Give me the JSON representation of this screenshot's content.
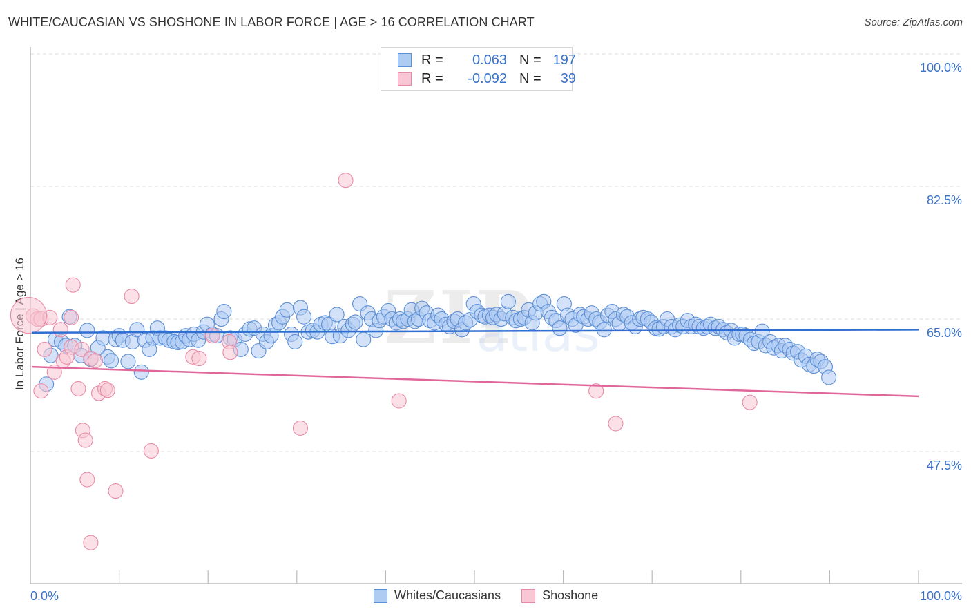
{
  "header": {
    "title": "WHITE/CAUCASIAN VS SHOSHONE IN LABOR FORCE | AGE > 16 CORRELATION CHART",
    "source": "Source: ZipAtlas.com"
  },
  "watermark": {
    "part1": "ZIP",
    "part2": "atlas"
  },
  "legend": {
    "rows": [
      {
        "r_label": "R =",
        "r_value": "0.063",
        "n_label": "N =",
        "n_value": "197",
        "color": "#aecbf2",
        "border": "#5b8fd6"
      },
      {
        "r_label": "R =",
        "r_value": "-0.092",
        "n_label": "N =",
        "n_value": "39",
        "color": "#f8c6d4",
        "border": "#e88aa6"
      }
    ]
  },
  "bottom_legend": {
    "items": [
      {
        "label": "Whites/Caucasians",
        "color": "#aecbf2",
        "border": "#5b8fd6"
      },
      {
        "label": "Shoshone",
        "color": "#f8c6d4",
        "border": "#e88aa6"
      }
    ]
  },
  "chart_data": {
    "type": "scatter",
    "title": "WHITE/CAUCASIAN VS SHOSHONE IN LABOR FORCE | AGE > 16 CORRELATION CHART",
    "xlabel": "",
    "ylabel": "In Labor Force | Age > 16",
    "xlim": [
      0,
      100
    ],
    "ylim": [
      30.5,
      102
    ],
    "x_tick_labels": [
      "0.0%",
      "100.0%"
    ],
    "y_ticks": [
      100.0,
      82.5,
      65.0,
      47.5
    ],
    "y_tick_labels": [
      "100.0%",
      "82.5%",
      "65.0%",
      "47.5%"
    ],
    "grid": true,
    "legend_position": "top-center",
    "series": [
      {
        "name": "Whites/Caucasians",
        "color": "#6b9ee0",
        "R": 0.063,
        "N": 197,
        "trend": {
          "x": [
            0,
            100
          ],
          "y": [
            63.2,
            63.6
          ]
        },
        "points": [
          [
            1.8,
            56.4
          ],
          [
            2.3,
            60.2
          ],
          [
            2.8,
            62.3
          ],
          [
            3.5,
            62.0
          ],
          [
            4.0,
            61.5
          ],
          [
            4.4,
            65.3
          ],
          [
            5.0,
            61.5
          ],
          [
            5.7,
            60.2
          ],
          [
            6.4,
            63.5
          ],
          [
            6.8,
            59.7
          ],
          [
            7.6,
            61.2
          ],
          [
            8.2,
            62.5
          ],
          [
            8.7,
            60.0
          ],
          [
            9.1,
            59.5
          ],
          [
            9.6,
            62.3
          ],
          [
            10.0,
            62.8
          ],
          [
            10.4,
            62.2
          ],
          [
            11.0,
            59.4
          ],
          [
            11.5,
            62.0
          ],
          [
            12.0,
            63.6
          ],
          [
            12.5,
            58.0
          ],
          [
            12.9,
            62.2
          ],
          [
            13.4,
            61.0
          ],
          [
            13.8,
            62.5
          ],
          [
            14.3,
            63.8
          ],
          [
            14.6,
            62.5
          ],
          [
            15.2,
            62.5
          ],
          [
            15.6,
            62.2
          ],
          [
            16.2,
            62.0
          ],
          [
            16.6,
            61.9
          ],
          [
            17.1,
            62.0
          ],
          [
            17.5,
            62.8
          ],
          [
            17.9,
            62.3
          ],
          [
            18.4,
            63.0
          ],
          [
            18.9,
            62.2
          ],
          [
            19.5,
            63.3
          ],
          [
            19.9,
            64.3
          ],
          [
            20.5,
            63.0
          ],
          [
            21.0,
            62.8
          ],
          [
            21.5,
            65.0
          ],
          [
            21.8,
            66.0
          ],
          [
            22.5,
            62.5
          ],
          [
            23.0,
            62.3
          ],
          [
            23.7,
            61.0
          ],
          [
            24.2,
            63.0
          ],
          [
            24.7,
            63.7
          ],
          [
            25.2,
            63.8
          ],
          [
            25.7,
            60.8
          ],
          [
            26.2,
            63.0
          ],
          [
            26.6,
            62.0
          ],
          [
            27.1,
            62.8
          ],
          [
            27.6,
            64.2
          ],
          [
            28.0,
            64.5
          ],
          [
            28.4,
            65.3
          ],
          [
            28.9,
            66.2
          ],
          [
            29.4,
            63.0
          ],
          [
            29.8,
            62.0
          ],
          [
            30.4,
            66.5
          ],
          [
            30.8,
            65.3
          ],
          [
            31.3,
            63.3
          ],
          [
            31.8,
            63.5
          ],
          [
            32.3,
            63.3
          ],
          [
            32.7,
            64.3
          ],
          [
            33.2,
            64.5
          ],
          [
            33.6,
            64.3
          ],
          [
            34.0,
            62.7
          ],
          [
            34.5,
            65.6
          ],
          [
            34.9,
            62.8
          ],
          [
            35.4,
            64.0
          ],
          [
            35.8,
            63.5
          ],
          [
            36.3,
            64.3
          ],
          [
            36.6,
            64.6
          ],
          [
            37.1,
            67.0
          ],
          [
            37.5,
            62.3
          ],
          [
            38.0,
            65.8
          ],
          [
            38.4,
            65.0
          ],
          [
            38.9,
            63.5
          ],
          [
            39.3,
            64.8
          ],
          [
            39.8,
            65.3
          ],
          [
            40.3,
            66.1
          ],
          [
            40.7,
            65.0
          ],
          [
            41.2,
            64.5
          ],
          [
            41.6,
            65.0
          ],
          [
            42.0,
            64.7
          ],
          [
            42.5,
            65.0
          ],
          [
            42.9,
            66.2
          ],
          [
            43.3,
            64.7
          ],
          [
            43.7,
            65.0
          ],
          [
            44.1,
            66.4
          ],
          [
            44.6,
            65.8
          ],
          [
            45.0,
            64.8
          ],
          [
            45.5,
            64.5
          ],
          [
            45.9,
            65.5
          ],
          [
            46.3,
            65.0
          ],
          [
            46.8,
            64.3
          ],
          [
            47.2,
            64.0
          ],
          [
            47.7,
            64.7
          ],
          [
            48.1,
            65.0
          ],
          [
            48.6,
            63.6
          ],
          [
            49.0,
            64.5
          ],
          [
            49.5,
            64.9
          ],
          [
            49.9,
            67.0
          ],
          [
            50.3,
            66.0
          ],
          [
            50.8,
            65.5
          ],
          [
            51.2,
            65.3
          ],
          [
            51.7,
            65.5
          ],
          [
            52.1,
            65.2
          ],
          [
            52.5,
            65.6
          ],
          [
            53.0,
            65.0
          ],
          [
            53.4,
            65.7
          ],
          [
            53.8,
            67.3
          ],
          [
            54.3,
            65.2
          ],
          [
            54.7,
            64.8
          ],
          [
            55.2,
            65.0
          ],
          [
            55.6,
            65.2
          ],
          [
            56.1,
            66.2
          ],
          [
            56.5,
            64.5
          ],
          [
            56.9,
            65.8
          ],
          [
            57.4,
            67.0
          ],
          [
            57.8,
            67.3
          ],
          [
            58.3,
            66.0
          ],
          [
            58.7,
            65.2
          ],
          [
            59.2,
            64.8
          ],
          [
            59.6,
            63.8
          ],
          [
            60.1,
            67.0
          ],
          [
            60.5,
            65.5
          ],
          [
            61.0,
            65.0
          ],
          [
            61.4,
            64.2
          ],
          [
            61.9,
            65.6
          ],
          [
            62.3,
            65.3
          ],
          [
            62.8,
            65.0
          ],
          [
            63.2,
            65.8
          ],
          [
            63.7,
            65.0
          ],
          [
            64.1,
            64.6
          ],
          [
            64.6,
            63.6
          ],
          [
            65.0,
            65.5
          ],
          [
            65.5,
            66.0
          ],
          [
            65.9,
            65.0
          ],
          [
            66.3,
            64.4
          ],
          [
            66.8,
            65.6
          ],
          [
            67.2,
            65.3
          ],
          [
            67.7,
            64.5
          ],
          [
            68.1,
            64.0
          ],
          [
            68.6,
            65.0
          ],
          [
            69.0,
            65.2
          ],
          [
            69.5,
            65.0
          ],
          [
            69.9,
            64.6
          ],
          [
            70.4,
            63.8
          ],
          [
            70.8,
            63.7
          ],
          [
            71.3,
            64.0
          ],
          [
            71.7,
            65.0
          ],
          [
            72.2,
            64.0
          ],
          [
            72.6,
            63.6
          ],
          [
            73.1,
            64.2
          ],
          [
            73.5,
            64.0
          ],
          [
            74.0,
            64.8
          ],
          [
            74.4,
            64.0
          ],
          [
            74.9,
            64.3
          ],
          [
            75.3,
            64.0
          ],
          [
            75.8,
            63.8
          ],
          [
            76.2,
            64.0
          ],
          [
            76.6,
            64.3
          ],
          [
            77.1,
            63.8
          ],
          [
            77.5,
            64.0
          ],
          [
            78.0,
            63.6
          ],
          [
            78.4,
            63.2
          ],
          [
            78.9,
            63.5
          ],
          [
            79.3,
            62.5
          ],
          [
            79.8,
            63.0
          ],
          [
            80.2,
            63.0
          ],
          [
            80.6,
            62.8
          ],
          [
            81.1,
            62.3
          ],
          [
            81.5,
            61.8
          ],
          [
            82.0,
            62.0
          ],
          [
            82.4,
            63.4
          ],
          [
            82.8,
            61.5
          ],
          [
            83.3,
            62.0
          ],
          [
            83.7,
            61.2
          ],
          [
            84.2,
            61.5
          ],
          [
            84.6,
            60.8
          ],
          [
            85.0,
            61.5
          ],
          [
            85.5,
            61.0
          ],
          [
            85.9,
            60.5
          ],
          [
            86.4,
            60.7
          ],
          [
            86.8,
            59.6
          ],
          [
            87.3,
            60.1
          ],
          [
            87.7,
            59.0
          ],
          [
            88.2,
            58.8
          ],
          [
            88.6,
            59.7
          ],
          [
            89.0,
            59.4
          ],
          [
            89.5,
            58.7
          ],
          [
            89.9,
            57.3
          ]
        ]
      },
      {
        "name": "Shoshone",
        "color": "#ec8fab",
        "R": -0.092,
        "N": 39,
        "trend": {
          "x": [
            0,
            100
          ],
          "y": [
            58.7,
            54.8
          ]
        },
        "points": [
          [
            0.3,
            65.4
          ],
          [
            0.8,
            65.0
          ],
          [
            1.2,
            65.0
          ],
          [
            1.2,
            55.5
          ],
          [
            1.6,
            61.0
          ],
          [
            2.2,
            65.2
          ],
          [
            2.7,
            58.0
          ],
          [
            3.4,
            63.6
          ],
          [
            3.7,
            59.5
          ],
          [
            4.1,
            60.0
          ],
          [
            4.6,
            65.2
          ],
          [
            4.6,
            61.3
          ],
          [
            4.8,
            69.5
          ],
          [
            5.4,
            55.8
          ],
          [
            5.8,
            61.0
          ],
          [
            5.9,
            50.3
          ],
          [
            6.2,
            49.0
          ],
          [
            6.4,
            43.8
          ],
          [
            6.8,
            59.8
          ],
          [
            6.8,
            35.5
          ],
          [
            7.3,
            59.5
          ],
          [
            7.7,
            55.2
          ],
          [
            8.4,
            55.8
          ],
          [
            8.7,
            55.6
          ],
          [
            9.6,
            42.3
          ],
          [
            11.4,
            68.0
          ],
          [
            13.6,
            47.6
          ],
          [
            18.3,
            60.0
          ],
          [
            19.0,
            59.8
          ],
          [
            20.5,
            62.8
          ],
          [
            22.4,
            62.0
          ],
          [
            22.5,
            60.6
          ],
          [
            30.4,
            50.6
          ],
          [
            35.5,
            83.3
          ],
          [
            41.5,
            54.2
          ],
          [
            63.7,
            55.5
          ],
          [
            65.9,
            51.2
          ],
          [
            81.0,
            54.0
          ],
          [
            -0.2,
            65.5
          ]
        ]
      }
    ]
  }
}
